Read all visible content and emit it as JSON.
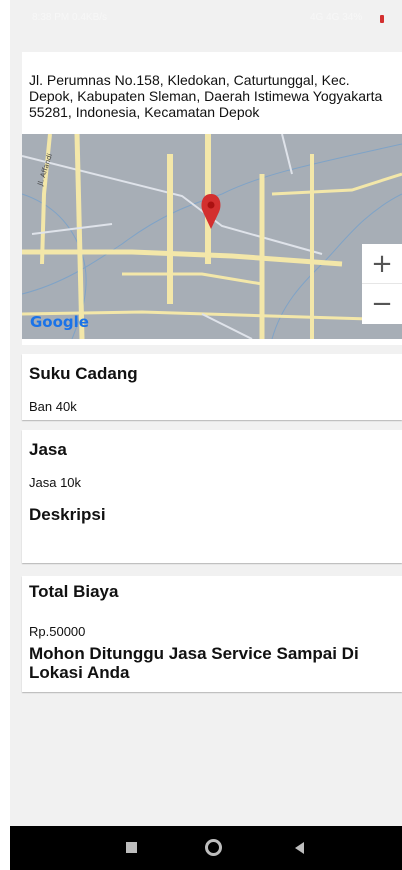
{
  "status_bar": {
    "left_text": "8:38 PM 0.4KB/s",
    "right_text": "4G 4G 34%"
  },
  "location": {
    "address": "Jl. Perumnas No.158, Kledokan, Caturtunggal, Kec. Depok, Kabupaten Sleman, Daerah Istimewa Yogyakarta 55281, Indonesia, Kecamatan Depok",
    "map": {
      "street_label": "Jl. Affandi",
      "attribution": "Google",
      "zoom_in_label": "+",
      "zoom_out_label": "−"
    }
  },
  "spare_parts": {
    "title": "Suku Cadang",
    "value": "Ban 40k"
  },
  "service": {
    "title": "Jasa",
    "value": "Jasa 10k",
    "description_title": "Deskripsi",
    "description_value": ""
  },
  "total": {
    "title": "Total Biaya",
    "value": "Rp.50000",
    "message": "Mohon Ditunggu Jasa Service Sampai Di Lokasi Anda"
  },
  "colors": {
    "pin": "#d32f2f",
    "map_roads": "#f3e7a9",
    "map_background": "#a7aeb6"
  },
  "nav": {
    "recents_icon": "square-icon",
    "home_icon": "circle-icon",
    "back_icon": "triangle-back-icon"
  }
}
